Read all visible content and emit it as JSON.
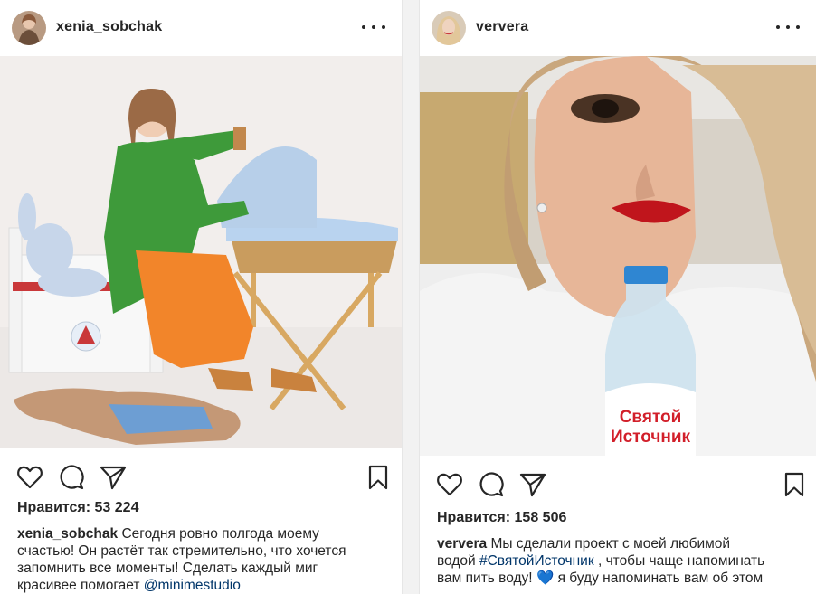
{
  "left_post": {
    "username": "xenia_sobchak",
    "likes": "Нравится: 53 224",
    "caption": {
      "username": "xenia_sobchak",
      "text_1": "Сегодня ровно полгода моему",
      "text_2": "счастью! Он растёт так стремительно, что хочется",
      "text_3": "запомнить все моменты! Сделать каждый миг",
      "text_4": "красивее помогает",
      "mention": "@minimestudio"
    }
  },
  "right_post": {
    "username": "ververa",
    "likes": "Нравится: 158 506",
    "bottle_label_1": "Святой",
    "bottle_label_2": "Источник",
    "caption": {
      "username": "ververa",
      "text_1": "Мы сделали проект с моей любимой",
      "text_2": "водой",
      "hashtag": "#СвятойИсточник",
      "text_3": ", чтобы чаще напоминать",
      "text_4": "вам пить воду!",
      "heart": "💙",
      "text_5": "я буду напоминать вам об этом"
    }
  },
  "icons": {
    "more": "more-dots-icon",
    "like": "heart-outline-icon",
    "comment": "comment-bubble-icon",
    "share": "paper-plane-icon",
    "save": "bookmark-icon"
  },
  "colors": {
    "text": "#262626",
    "link": "#003569",
    "emoji_heart": "#3a86ff"
  }
}
